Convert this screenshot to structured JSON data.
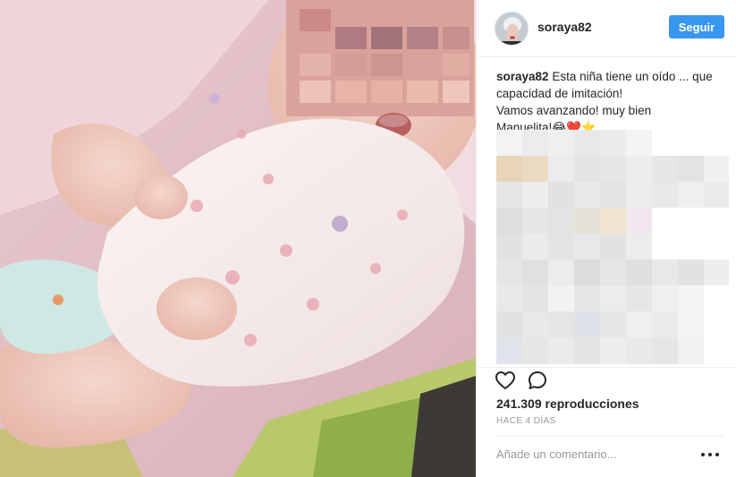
{
  "account": {
    "username": "soraya82"
  },
  "header": {
    "follow_label": "Seguir"
  },
  "caption": {
    "username": "soraya82",
    "lines": [
      "Esta niña tiene un oído ... que",
      "capacidad de imitación!",
      "Vamos avanzando! muy bien",
      "Manuelita!😂❤️⭐"
    ]
  },
  "actions": {
    "like_icon": "heart-icon",
    "comment_icon": "comment-icon"
  },
  "stats": {
    "views": "241.309 reproducciones",
    "time": "HACE 4 DÍAS"
  },
  "comment_box": {
    "placeholder": "Añade un comentario..."
  },
  "colors": {
    "accent": "#3897f0",
    "text": "#262626",
    "muted": "#999999",
    "border": "#efefef"
  }
}
